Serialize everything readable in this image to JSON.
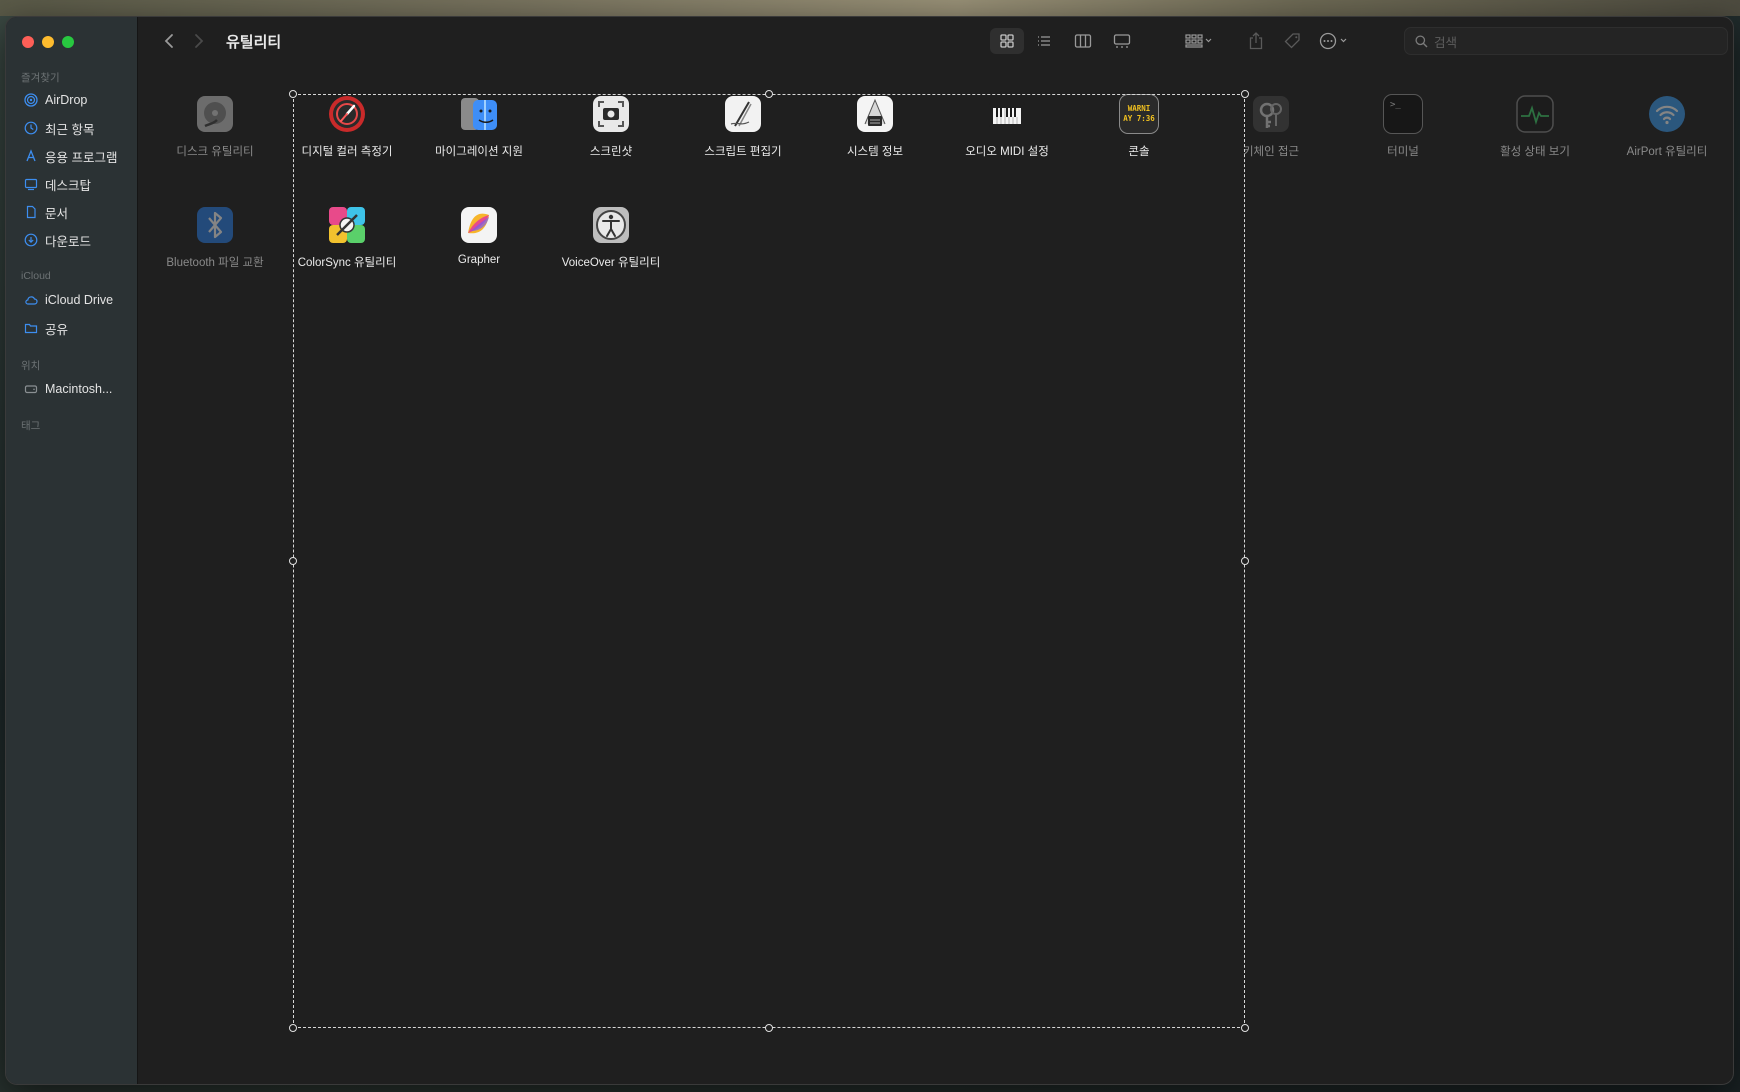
{
  "window": {
    "title": "유틸리티"
  },
  "sidebar": {
    "sections": [
      {
        "label": "즐겨찾기"
      },
      {
        "label": "iCloud"
      },
      {
        "label": "위치"
      },
      {
        "label": "태그"
      }
    ],
    "items": [
      {
        "label": "AirDrop",
        "icon": "airdrop-icon"
      },
      {
        "label": "최근 항목",
        "icon": "clock-icon"
      },
      {
        "label": "응용 프로그램",
        "icon": "applications-icon"
      },
      {
        "label": "데스크탑",
        "icon": "desktop-icon"
      },
      {
        "label": "문서",
        "icon": "document-icon"
      },
      {
        "label": "다운로드",
        "icon": "download-icon"
      },
      {
        "label": "iCloud Drive",
        "icon": "cloud-icon"
      },
      {
        "label": "공유",
        "icon": "shared-folder-icon"
      },
      {
        "label": "Macintosh...",
        "icon": "drive-icon"
      }
    ]
  },
  "toolbar": {
    "search_placeholder": "검색"
  },
  "files": [
    {
      "label": "디스크 유틸리티",
      "icon": "disk-utility-icon",
      "selected": false
    },
    {
      "label": "디지털 컬러 측정기",
      "icon": "digital-color-meter-icon",
      "selected": true
    },
    {
      "label": "마이그레이션 지원",
      "icon": "migration-assistant-icon",
      "selected": true
    },
    {
      "label": "스크린샷",
      "icon": "screenshot-icon",
      "selected": true
    },
    {
      "label": "스크립트 편집기",
      "icon": "script-editor-icon",
      "selected": true
    },
    {
      "label": "시스템 정보",
      "icon": "system-information-icon",
      "selected": true
    },
    {
      "label": "오디오 MIDI 설정",
      "icon": "audio-midi-icon",
      "selected": true
    },
    {
      "label": "콘솔",
      "icon": "console-icon",
      "selected": true
    },
    {
      "label": "키체인 접근",
      "icon": "keychain-icon",
      "selected": false
    },
    {
      "label": "터미널",
      "icon": "terminal-icon",
      "selected": false
    },
    {
      "label": "활성 상태 보기",
      "icon": "activity-monitor-icon",
      "selected": false
    },
    {
      "label": "AirPort 유틸리티",
      "icon": "airport-utility-icon",
      "selected": false
    },
    {
      "label": "Bluetooth 파일 교환",
      "icon": "bluetooth-icon",
      "selected": false
    },
    {
      "label": "ColorSync 유틸리티",
      "icon": "colorsync-icon",
      "selected": true
    },
    {
      "label": "Grapher",
      "icon": "grapher-icon",
      "selected": true
    },
    {
      "label": "VoiceOver 유틸리티",
      "icon": "voiceover-icon",
      "selected": true
    }
  ],
  "console_icon_text": {
    "line1": "WARNI",
    "line2": "AY 7:36"
  },
  "terminal_prompt": ">_",
  "colors": {
    "accent": "#0a84ff",
    "window_bg": "#1f1f1f",
    "sidebar_bg": "#2c3436"
  }
}
